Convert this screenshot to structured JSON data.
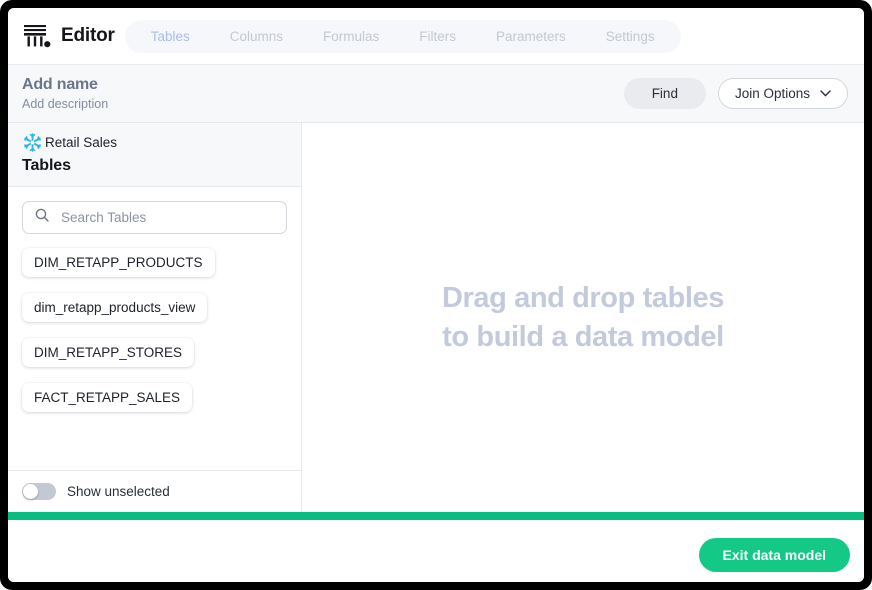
{
  "app": {
    "logo_icon": "pillar-logo-icon",
    "name": "Editor"
  },
  "tabs": [
    {
      "label": "Tables",
      "active": true
    },
    {
      "label": "Columns",
      "active": false
    },
    {
      "label": "Formulas",
      "active": false
    },
    {
      "label": "Filters",
      "active": false
    },
    {
      "label": "Parameters",
      "active": false
    },
    {
      "label": "Settings",
      "active": false
    }
  ],
  "subheader": {
    "title": "Add name",
    "description": "Add description",
    "find_label": "Find",
    "join_options_label": "Join Options",
    "chevron_icon": "chevron-down-icon"
  },
  "sidebar": {
    "source_icon": "snowflake-icon",
    "source_name": "Retail Sales",
    "section_title": "Tables",
    "search": {
      "icon": "search-icon",
      "placeholder": "Search Tables",
      "value": ""
    },
    "tables": [
      {
        "label": "DIM_RETAPP_PRODUCTS"
      },
      {
        "label": "dim_retapp_products_view"
      },
      {
        "label": "DIM_RETAPP_STORES"
      },
      {
        "label": "FACT_RETAPP_SALES"
      }
    ],
    "toggle": {
      "label": "Show unselected",
      "state": "off"
    }
  },
  "canvas": {
    "empty_line1": "Drag and drop tables",
    "empty_line2": "to build a data model"
  },
  "footer": {
    "exit_label": "Exit data model"
  },
  "colors": {
    "accent_green": "#09bd80",
    "button_green": "#14c885",
    "snowflake_blue": "#29b5e8",
    "active_tab_blue": "#a8beec"
  }
}
